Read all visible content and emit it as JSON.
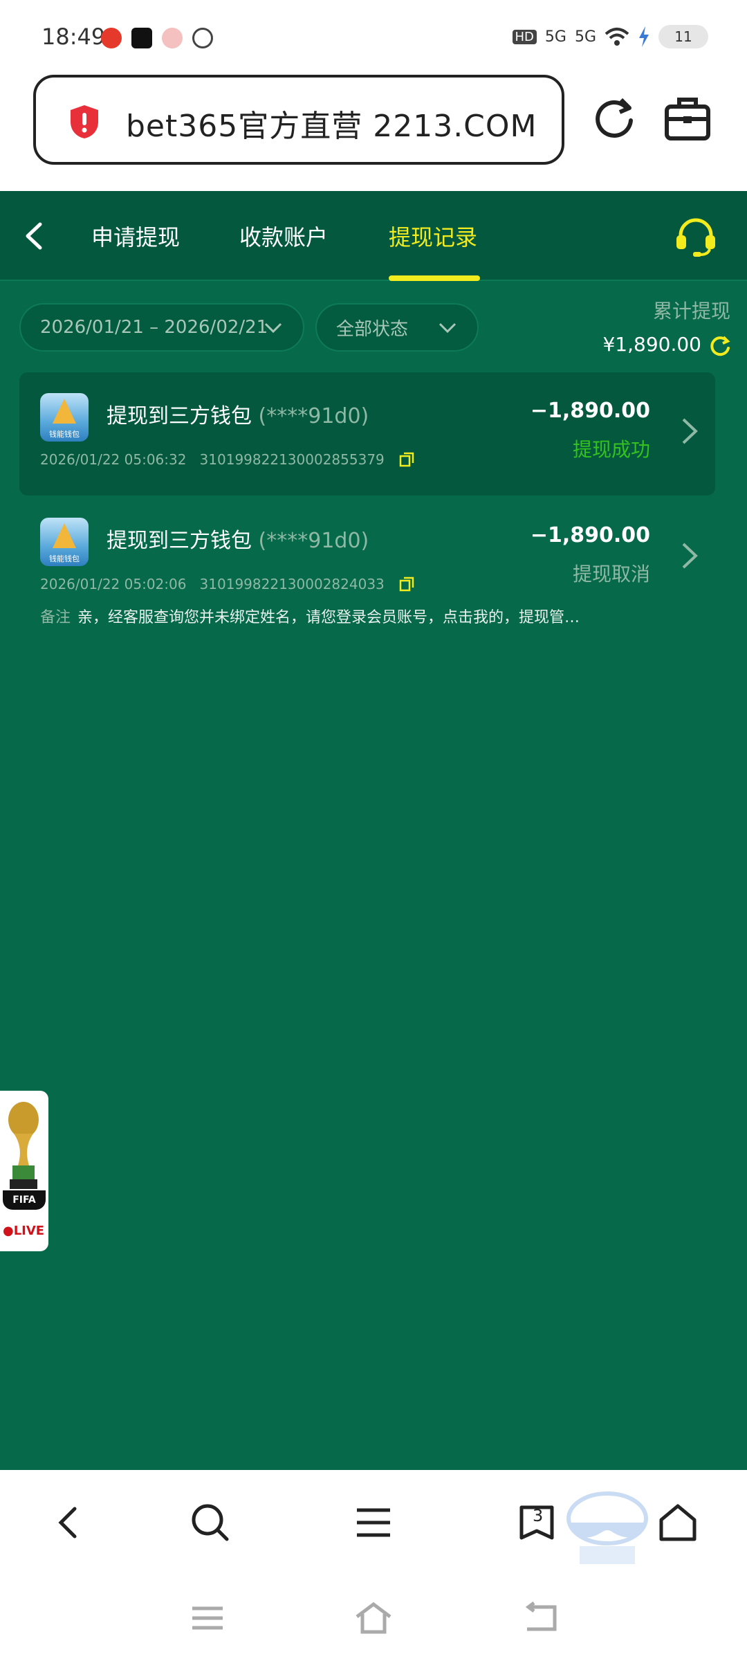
{
  "status_bar": {
    "time": "18:49",
    "network_hd": "HD",
    "network_1": "5G",
    "network_2": "5G",
    "battery": "11"
  },
  "address_bar": {
    "url": "bet365官方直营  2213.COM"
  },
  "nav": {
    "tabs": [
      {
        "label": "申请提现"
      },
      {
        "label": "收款账户"
      },
      {
        "label": "提现记录"
      }
    ],
    "active_tab": "提现记录"
  },
  "filters": {
    "date_range": "2026/01/21 – 2026/02/21",
    "status": "全部状态"
  },
  "summary": {
    "label": "累计提现",
    "value": "¥1,890.00"
  },
  "records": [
    {
      "title": "提现到三方钱包",
      "account": "(****91d0)",
      "datetime": "2026/01/22  05:06:32",
      "order_id": "3101998221300028553​79",
      "amount": "−1,890.00",
      "status": "提现成功",
      "status_color": "#33c21e"
    },
    {
      "title": "提现到三方钱包",
      "account": "(****91d0)",
      "datetime": "2026/01/22  05:02:06",
      "order_id": "310199822130002824033",
      "amount": "−1,890.00",
      "status": "提现取消",
      "status_color": "#8fb8a5",
      "note_label": "备注",
      "note": "亲，经客服查询您并未绑定姓名，请您登录会员账号，点击我的，提现管…"
    }
  ],
  "float_ad": {
    "badge": "FIFA",
    "live": "●LIVE"
  },
  "toolbar": {
    "tab_count": "3"
  },
  "colors": {
    "page_bg": "#05694a",
    "nav_bg": "#03583e",
    "accent": "#f2ec1f"
  }
}
